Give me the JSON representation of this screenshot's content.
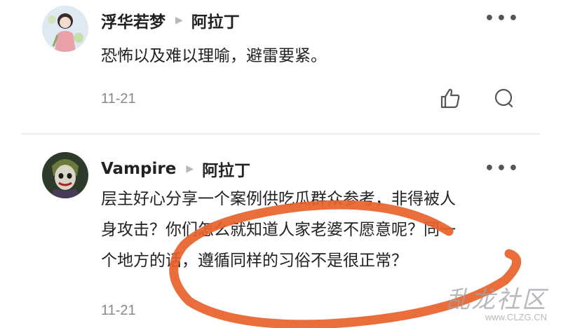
{
  "comments": [
    {
      "author": "浮华若梦",
      "reply_to": "阿拉丁",
      "text": "恐怖以及难以理喻，避雷要紧。",
      "date": "11-21"
    },
    {
      "author": "Vampire",
      "reply_to": "阿拉丁",
      "text_lines": [
        "层主好心分享一个案例供吃瓜群众参考，非得被人",
        "身攻击？你们怎么就知道人家老婆不愿意呢？同一",
        "个地方的话，遵循同样的习俗不是很正常？"
      ],
      "date": "11-21"
    }
  ],
  "icons": {
    "more": "more-icon",
    "like": "thumbs-up-icon",
    "reply": "comment-bubble-icon",
    "reply_arrow": "reply-arrow-icon"
  },
  "watermark": {
    "main": "乱龙社区",
    "sub": "www.CLZG.CN"
  },
  "colors": {
    "annotation": "#e8622a",
    "text": "#222222",
    "meta": "#888888"
  }
}
